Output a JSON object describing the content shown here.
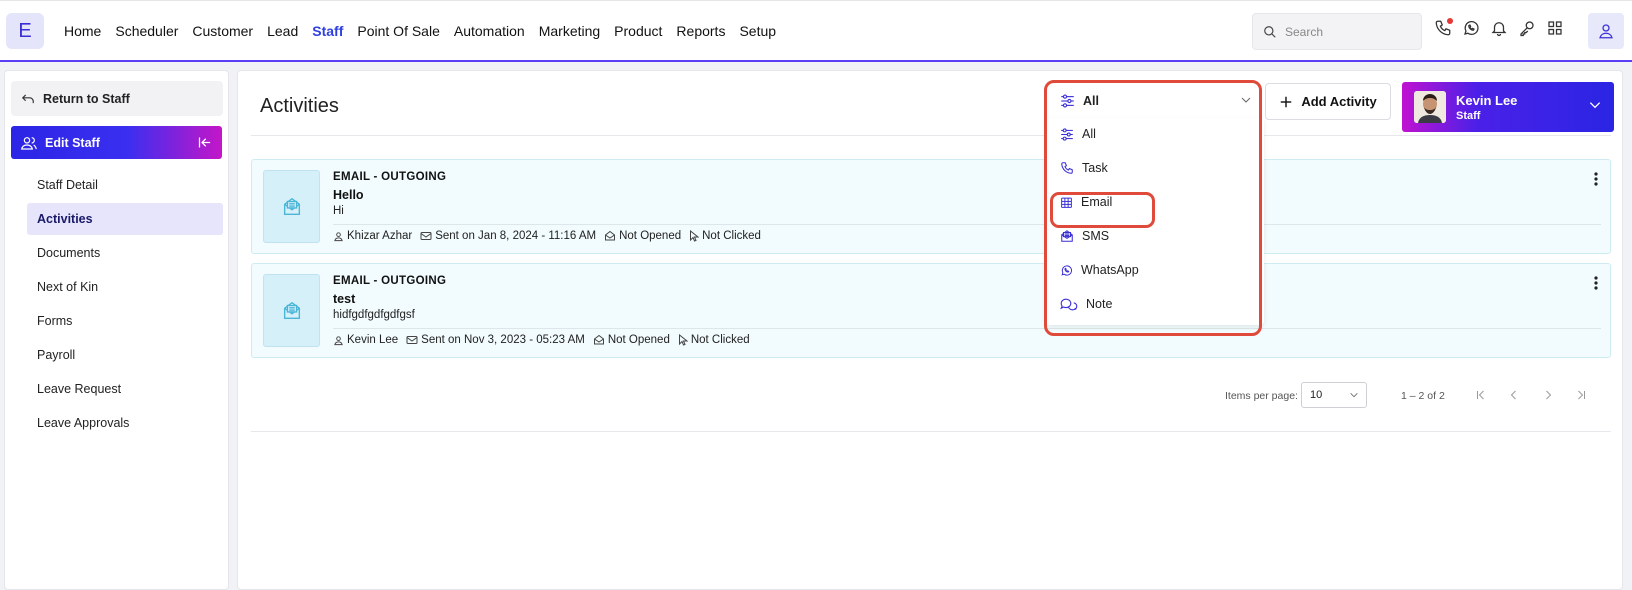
{
  "app": {
    "logo_letter": "E"
  },
  "nav": {
    "items": [
      "Home",
      "Scheduler",
      "Customer",
      "Lead",
      "Staff",
      "Point Of Sale",
      "Automation",
      "Marketing",
      "Product",
      "Reports",
      "Setup"
    ],
    "active": "Staff",
    "search_placeholder": "Search"
  },
  "top_icons": [
    "phone-icon",
    "whatsapp-icon",
    "bell-icon",
    "key-icon",
    "apps-grid-icon",
    "user-icon"
  ],
  "sidebar": {
    "return_label": "Return to Staff",
    "section_title": "Edit Staff",
    "items": [
      "Staff Detail",
      "Activities",
      "Documents",
      "Next of Kin",
      "Forms",
      "Payroll",
      "Leave Request",
      "Leave Approvals"
    ],
    "active": "Activities"
  },
  "main": {
    "title": "Activities",
    "filter": {
      "selected": "All"
    },
    "add_activity_label": "Add Activity",
    "profile": {
      "name": "Kevin Lee",
      "role": "Staff"
    }
  },
  "activities": [
    {
      "type": "EMAIL - OUTGOING",
      "subject": "Hello",
      "body": "Hi",
      "user": "Khizar Azhar",
      "sent": "Sent on Jan 8, 2024 - 11:16 AM",
      "opened": "Not Opened",
      "clicked": "Not Clicked"
    },
    {
      "type": "EMAIL - OUTGOING",
      "subject": "test",
      "body": "hidfgdfgdfgdfgsf",
      "user": "Kevin Lee",
      "sent": "Sent on Nov 3, 2023 - 05:23 AM",
      "opened": "Not Opened",
      "clicked": "Not Clicked"
    }
  ],
  "pagination": {
    "items_per_page_label": "Items per page:",
    "items_per_page": "10",
    "range": "1 – 2 of 2"
  },
  "dropdown": {
    "options": [
      {
        "label": "All",
        "icon": "filter-sliders-icon"
      },
      {
        "label": "Task",
        "icon": "phone-icon"
      },
      {
        "label": "Email",
        "icon": "calendar-grid-icon"
      },
      {
        "label": "SMS",
        "icon": "sms-icon"
      },
      {
        "label": "WhatsApp",
        "icon": "whatsapp-icon"
      },
      {
        "label": "Note",
        "icon": "chat-icon"
      }
    ],
    "highlighted": "Email"
  },
  "colors": {
    "accent": "#2f3fe0",
    "gradient_start": "#2c25e6",
    "gradient_end": "#c416c8",
    "card_bg": "#f2fbfd",
    "highlight": "#e04a3a"
  }
}
